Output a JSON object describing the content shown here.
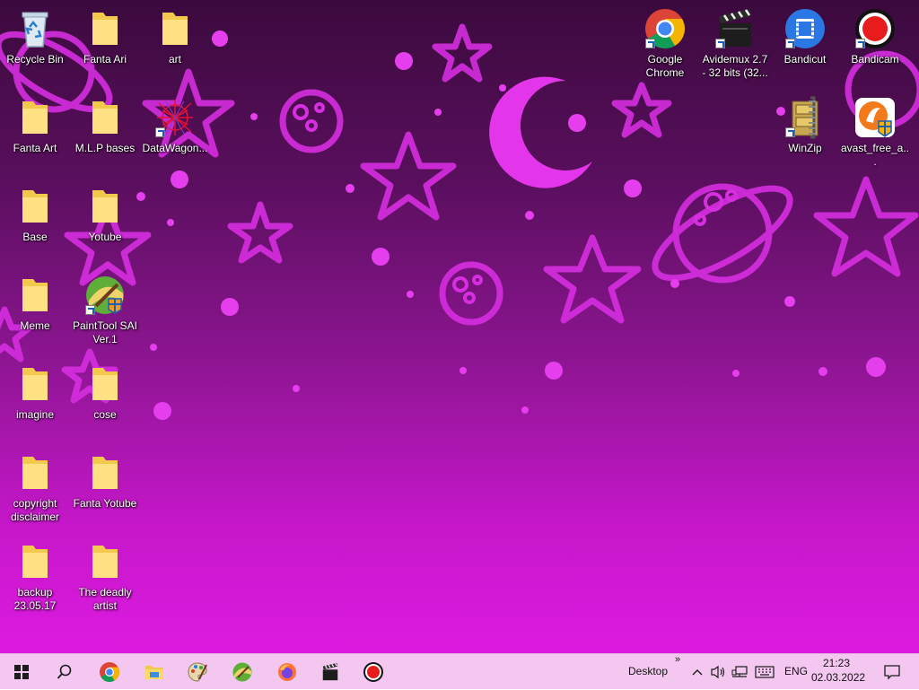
{
  "desktop": {
    "icons_left": [
      {
        "name": "recycle-bin",
        "label": "Recycle Bin",
        "kind": "recycle"
      },
      {
        "name": "fanta-ari",
        "label": "Fanta Ari",
        "kind": "folder"
      },
      {
        "name": "art",
        "label": "art",
        "kind": "folder"
      },
      {
        "name": "fanta-art",
        "label": "Fanta Art",
        "kind": "folder"
      },
      {
        "name": "mlp-bases",
        "label": "M.L.P bases",
        "kind": "folder"
      },
      {
        "name": "datawagon",
        "label": "DataWagon...",
        "kind": "app"
      },
      {
        "name": "base",
        "label": "Base",
        "kind": "folder"
      },
      {
        "name": "yotube",
        "label": "Yotube",
        "kind": "folder"
      },
      {
        "name": "meme",
        "label": "Meme",
        "kind": "folder"
      },
      {
        "name": "painttool-sai",
        "label": "PaintTool SAI Ver.1",
        "kind": "app"
      },
      {
        "name": "imagine",
        "label": "imagine",
        "kind": "folder"
      },
      {
        "name": "cose",
        "label": "cose",
        "kind": "folder"
      },
      {
        "name": "copyright-disclaimer",
        "label": "copyright disclaimer",
        "kind": "folder"
      },
      {
        "name": "fanta-yotube",
        "label": "Fanta Yotube",
        "kind": "folder"
      },
      {
        "name": "backup",
        "label": "backup 23.05.17",
        "kind": "folder"
      },
      {
        "name": "the-deadly-artist",
        "label": "The deadly artist",
        "kind": "folder"
      }
    ],
    "icons_right": [
      {
        "name": "google-chrome",
        "label": "Google Chrome"
      },
      {
        "name": "avidemux",
        "label": "Avidemux 2.7 - 32 bits (32..."
      },
      {
        "name": "bandicut",
        "label": "Bandicut"
      },
      {
        "name": "bandicam",
        "label": "Bandicam"
      },
      {
        "name": "winzip",
        "label": "WinZip"
      },
      {
        "name": "avast",
        "label": "avast_free_a..."
      }
    ]
  },
  "taskbar": {
    "desktop_label": "Desktop",
    "overflow_chevron": "»",
    "language": "ENG",
    "time": "21:23",
    "date": "02.03.2022"
  },
  "colors": {
    "taskbar_bg": "#f3c7f0",
    "wallpaper_dark": "#3b0a3d",
    "wallpaper_bright": "#dd1ae0",
    "shape_pink": "#e535e8"
  }
}
